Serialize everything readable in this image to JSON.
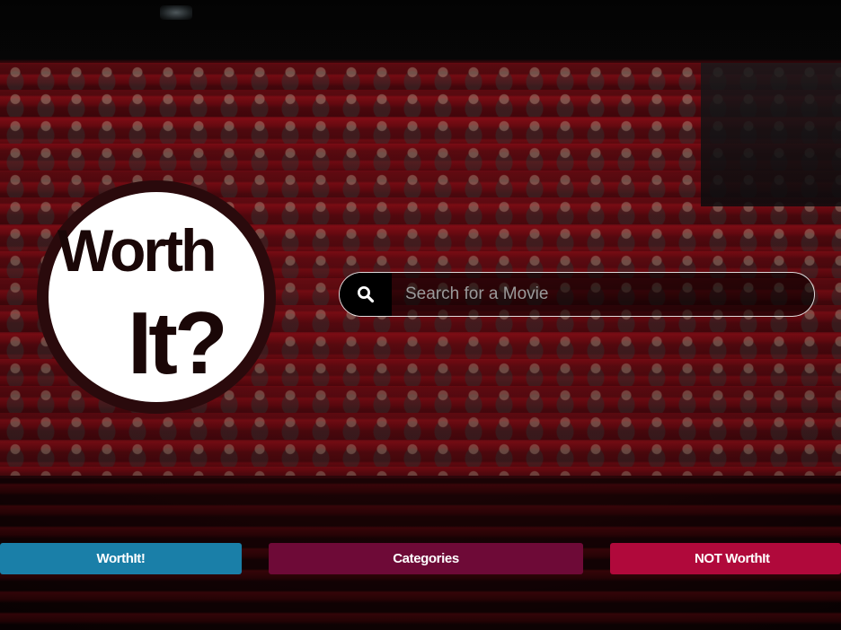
{
  "logo": {
    "line1": "Worth",
    "line2": "It?",
    "icon": "worth-it-logo"
  },
  "search": {
    "icon": "search-icon",
    "placeholder": "Search for a Movie",
    "value": ""
  },
  "nav": {
    "items": [
      {
        "label": "WorthIt!",
        "color": "#1a7fa8"
      },
      {
        "label": "Categories",
        "color": "#6e0a37"
      },
      {
        "label": "NOT WorthIt",
        "color": "#b0093b"
      }
    ]
  },
  "colors": {
    "logo_circle": "#ffffff",
    "logo_ring": "#2a0a0c",
    "logo_text": "#1a0707",
    "search_border": "#ffffff"
  }
}
